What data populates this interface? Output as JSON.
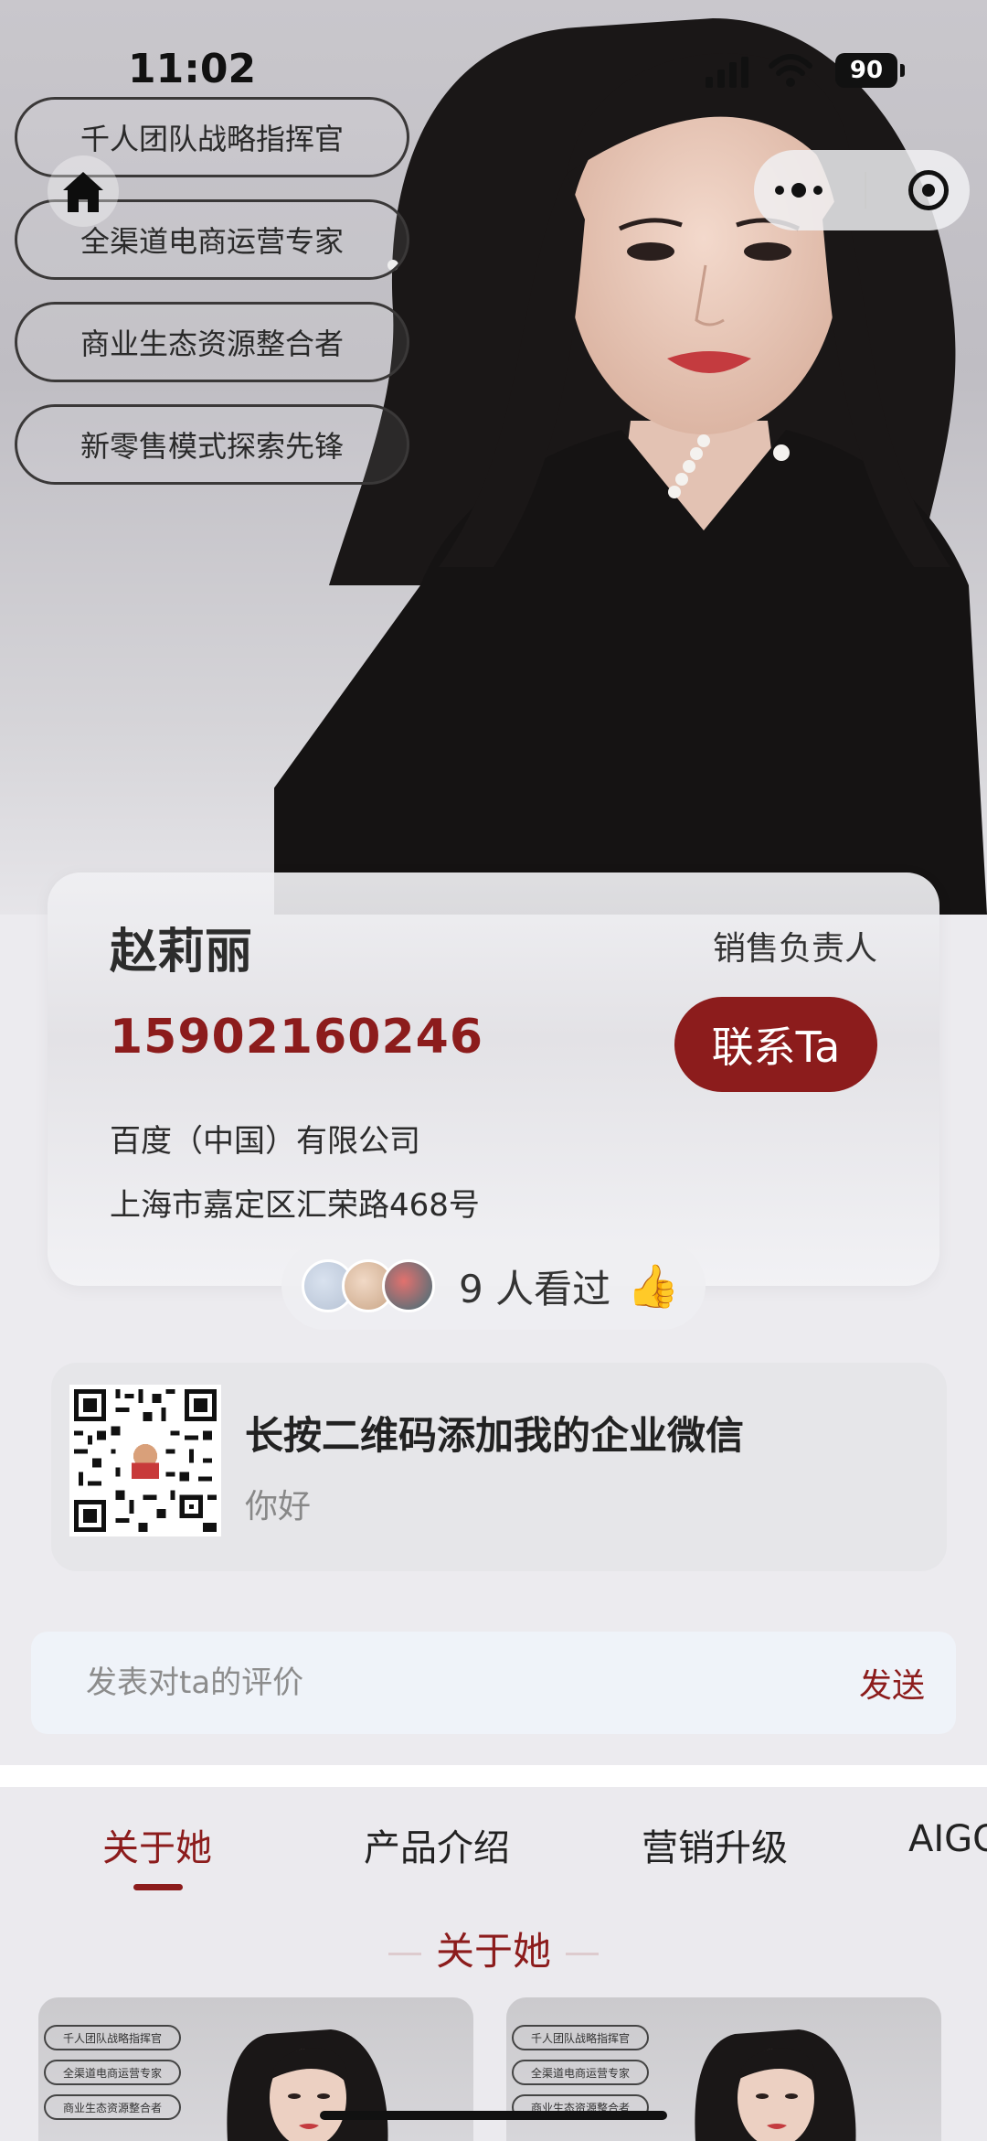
{
  "status_bar": {
    "time": "11:02",
    "battery": "90"
  },
  "tags": [
    "千人团队战略指挥官",
    "全渠道电商运营专家",
    "商业生态资源整合者",
    "新零售模式探索先锋"
  ],
  "profile": {
    "name": "赵莉丽",
    "role": "销售负责人",
    "phone": "15902160246",
    "contact_button": "联系Ta",
    "company": "百度（中国）有限公司",
    "address": "上海市嘉定区汇荣路468号"
  },
  "viewers": {
    "text": "9 人看过",
    "thumb": "👍"
  },
  "qr": {
    "title": "长按二维码添加我的企业微信",
    "subtitle": "你好"
  },
  "comment": {
    "placeholder": "发表对ta的评价",
    "send_label": "发送"
  },
  "tabs": [
    {
      "label": "关于她",
      "active": true
    },
    {
      "label": "产品介绍",
      "active": false
    },
    {
      "label": "营销升级",
      "active": false
    },
    {
      "label": "AIGC",
      "active": false
    }
  ],
  "section_title": "关于她",
  "mini_tags": [
    "千人团队战略指挥官",
    "全渠道电商运营专家",
    "商业生态资源整合者"
  ],
  "colors": {
    "accent": "#8c1c1c",
    "background": "#ecebef"
  }
}
